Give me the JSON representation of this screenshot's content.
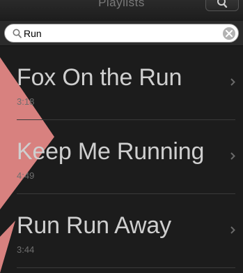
{
  "header": {
    "title": "Playlists"
  },
  "search": {
    "value": "Run",
    "placeholder": ""
  },
  "songs": [
    {
      "title": "Fox On the Run",
      "duration": "3:18"
    },
    {
      "title": "Keep Me Running",
      "duration": "4:49"
    },
    {
      "title": "Run Run Away",
      "duration": "3:44"
    }
  ],
  "icons": {
    "header_search": "search-icon",
    "field_search": "search-icon",
    "clear": "clear-icon",
    "row_arrow": "chevron-right-icon"
  },
  "colors": {
    "background": "#1c1c1c",
    "accent_decor": "#e88a88",
    "title_text": "#cfcfcf",
    "duration_text": "#6e6e6e"
  }
}
